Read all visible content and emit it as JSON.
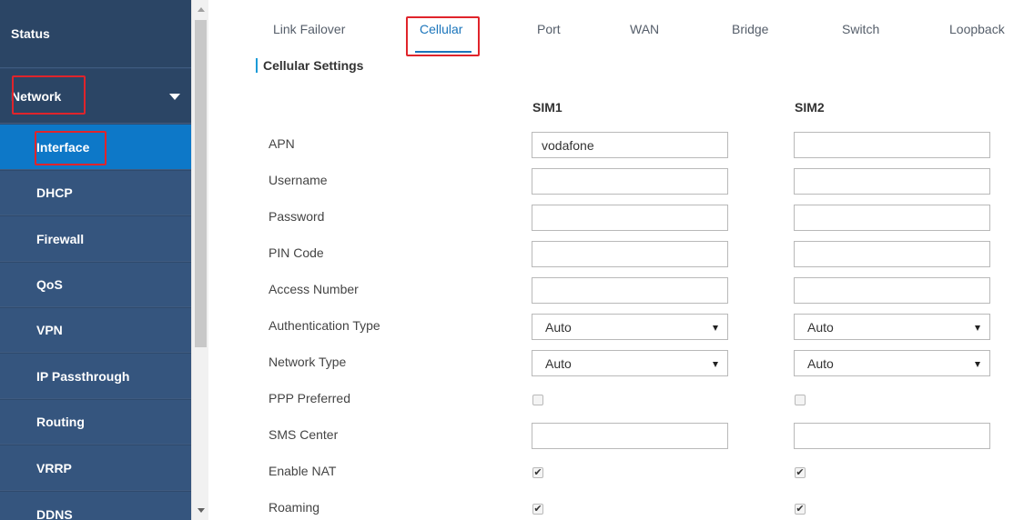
{
  "sidebar": {
    "items": [
      {
        "label": "Status"
      },
      {
        "label": "Network"
      },
      {
        "label": "Interface"
      },
      {
        "label": "DHCP"
      },
      {
        "label": "Firewall"
      },
      {
        "label": "QoS"
      },
      {
        "label": "VPN"
      },
      {
        "label": "IP Passthrough"
      },
      {
        "label": "Routing"
      },
      {
        "label": "VRRP"
      },
      {
        "label": "DDNS"
      }
    ]
  },
  "tabs": [
    {
      "label": "Link Failover"
    },
    {
      "label": "Cellular"
    },
    {
      "label": "Port"
    },
    {
      "label": "WAN"
    },
    {
      "label": "Bridge"
    },
    {
      "label": "Switch"
    },
    {
      "label": "Loopback"
    }
  ],
  "section": {
    "title": "Cellular Settings"
  },
  "columns": {
    "sim1": "SIM1",
    "sim2": "SIM2"
  },
  "fields": {
    "apn": {
      "label": "APN",
      "sim1": "vodafone",
      "sim2": ""
    },
    "username": {
      "label": "Username",
      "sim1": "",
      "sim2": ""
    },
    "password": {
      "label": "Password",
      "sim1": "",
      "sim2": ""
    },
    "pin": {
      "label": "PIN Code",
      "sim1": "",
      "sim2": ""
    },
    "access_number": {
      "label": "Access Number",
      "sim1": "",
      "sim2": ""
    },
    "auth_type": {
      "label": "Authentication Type",
      "sim1": "Auto",
      "sim2": "Auto"
    },
    "network_type": {
      "label": "Network Type",
      "sim1": "Auto",
      "sim2": "Auto"
    },
    "ppp_preferred": {
      "label": "PPP Preferred",
      "sim1": false,
      "sim2": false
    },
    "sms_center": {
      "label": "SMS Center",
      "sim1": "",
      "sim2": ""
    },
    "enable_nat": {
      "label": "Enable NAT",
      "sim1": true,
      "sim2": true
    },
    "roaming": {
      "label": "Roaming",
      "sim1": true,
      "sim2": true
    }
  },
  "colors": {
    "sidebar": "#2f4a6d",
    "active": "#0d78c8",
    "accent": "#1b75bb",
    "highlight": "#e0242b"
  }
}
